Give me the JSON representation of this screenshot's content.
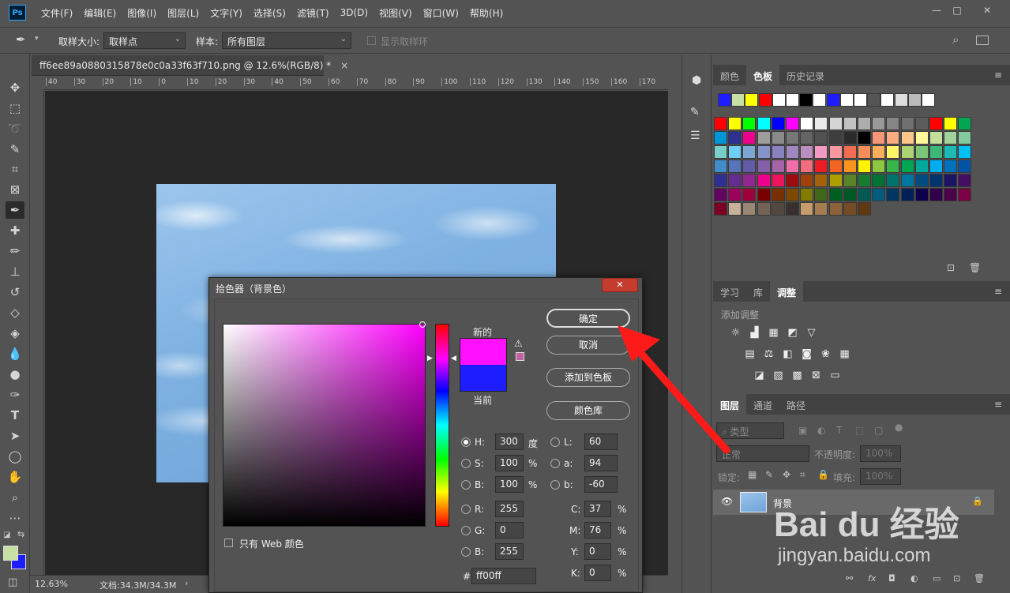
{
  "app": {
    "logo": "Ps"
  },
  "menu": [
    "文件(F)",
    "编辑(E)",
    "图像(I)",
    "图层(L)",
    "文字(Y)",
    "选择(S)",
    "滤镜(T)",
    "3D(D)",
    "视图(V)",
    "窗口(W)",
    "帮助(H)"
  ],
  "window_controls": {
    "minimize": "—",
    "restore": "□",
    "close": "✕"
  },
  "options": {
    "sample_size_label": "取样大小:",
    "sample_size_value": "取样点",
    "sample_label": "样本:",
    "sample_value": "所有图层",
    "show_ring_label": "显示取样环"
  },
  "document": {
    "tab_title": "ff6ee89a0880315878e0c0a33f63f710.png @ 12.6%(RGB/8) *",
    "close": "×",
    "ruler_ticks": [
      "40",
      "30",
      "20",
      "10",
      "0",
      "10",
      "20",
      "30",
      "40",
      "50",
      "60",
      "70",
      "80",
      "90",
      "100",
      "110",
      "120",
      "130",
      "140",
      "150",
      "160",
      "170"
    ]
  },
  "status": {
    "zoom": "12.63%",
    "doc_info": "文档:34.3M/34.3M",
    "arrow": "›"
  },
  "panels": {
    "color_tabs": [
      "颜色",
      "色板",
      "历史记录"
    ],
    "adjust_tabs": [
      "学习",
      "库",
      "调整"
    ],
    "adjust_add": "添加调整",
    "layers_tabs": [
      "图层",
      "通道",
      "路径"
    ],
    "layers": {
      "kind": "类型",
      "blend": "正常",
      "opacity_label": "不透明度:",
      "opacity": "100%",
      "lock_label": "锁定:",
      "fill_label": "填充:",
      "fill": "100%",
      "layer_name": "背景"
    }
  },
  "swatches": {
    "recent": [
      "#1d1dff",
      "#c9e0a5",
      "#ffff00",
      "#ff0000",
      "#ffffff",
      "#ffffff",
      "#000000",
      "#ffffff",
      "#1d1dff",
      "#ffffff",
      "#ffffff",
      "#555555",
      "#ffffff",
      "#dddddd",
      "#bbbbbb",
      "#ffffff"
    ],
    "grid": [
      [
        "#ff0000",
        "#ffff00",
        "#00ff00",
        "#00ffff",
        "#0000ff",
        "#ff00ff",
        "#ffffff",
        "#ebebeb",
        "#d6d6d6",
        "#c2c2c2",
        "#adadad",
        "#999999",
        "#858585",
        "#707070",
        "#5c5c5c",
        "#ff0000",
        "#ffff00",
        "#00a651"
      ],
      [
        "#0095d9",
        "#2e3192",
        "#ec008c",
        "#9d9d9d",
        "#8a8a8a",
        "#777777",
        "#646464",
        "#515151",
        "#3e3e3e",
        "#2b2b2b",
        "#000000",
        "#f7977a",
        "#f9ad81",
        "#fdc68a",
        "#fff79a",
        "#c4df9b",
        "#a2d39c",
        "#82ca9d"
      ],
      [
        "#7bcdc8",
        "#6ecff6",
        "#7ea7d8",
        "#8493ca",
        "#8882be",
        "#a187be",
        "#bc8dbf",
        "#f49ac2",
        "#f6989d",
        "#f26c4f",
        "#f68e55",
        "#fbaf5c",
        "#fff467",
        "#acd372",
        "#7cc576",
        "#3bb878",
        "#1abbb4",
        "#00bff3"
      ],
      [
        "#438cca",
        "#5574b9",
        "#605ca8",
        "#855fa8",
        "#a763a8",
        "#f06ea9",
        "#f26d7d",
        "#ed1c24",
        "#f26522",
        "#f7941d",
        "#fff200",
        "#8dc73f",
        "#39b54a",
        "#00a651",
        "#00a99d",
        "#00aeef",
        "#0072bc",
        "#0054a6"
      ],
      [
        "#2e3192",
        "#662d91",
        "#92278f",
        "#ec008c",
        "#ed145b",
        "#9e0b0f",
        "#a0410d",
        "#a36209",
        "#aba000",
        "#598527",
        "#197b30",
        "#007236",
        "#00746b",
        "#0076a3",
        "#004b80",
        "#003471",
        "#1b1464",
        "#440e62"
      ],
      [
        "#630460",
        "#9e005d",
        "#9e0039",
        "#790000",
        "#7b2e00",
        "#7d4900",
        "#827b00",
        "#406618",
        "#005e20",
        "#005826",
        "#005952",
        "#005b7f",
        "#003663",
        "#002157",
        "#0d004c",
        "#32004b",
        "#4b0049",
        "#7b0046"
      ],
      [
        "#7a0026",
        "#c7b299",
        "#998675",
        "#736357",
        "#534741",
        "#37302d",
        "#c69c6d",
        "#a67c52",
        "#8c6239",
        "#754c24",
        "#603913"
      ]
    ]
  },
  "dialog": {
    "title": "拾色器（背景色）",
    "close": "✕",
    "new_label": "新的",
    "current_label": "当前",
    "buttons": {
      "ok": "确定",
      "cancel": "取消",
      "add_swatch": "添加到色板",
      "libraries": "颜色库"
    },
    "fields": {
      "H": "300",
      "S": "100",
      "B": "100",
      "L": "60",
      "a": "94",
      "b2": "-60",
      "R": "255",
      "G": "0",
      "B2": "255",
      "C": "37",
      "M": "76",
      "Y": "0",
      "K": "0",
      "hex": "ff00ff"
    },
    "units": {
      "deg": "度",
      "pct": "%"
    },
    "labels": {
      "H": "H:",
      "S": "S:",
      "B": "B:",
      "L": "L:",
      "a": "a:",
      "b": "b:",
      "R": "R:",
      "G": "G:",
      "B2": "B:",
      "C": "C:",
      "M": "M:",
      "Y": "Y:",
      "K": "K:",
      "hash": "#"
    },
    "web_only": "只有 Web 颜色",
    "colors": {
      "new": "#ff10ff",
      "current": "#1d1dff"
    }
  },
  "watermark": {
    "text": "Bai du 经验",
    "url": "jingyan.baidu.com"
  }
}
